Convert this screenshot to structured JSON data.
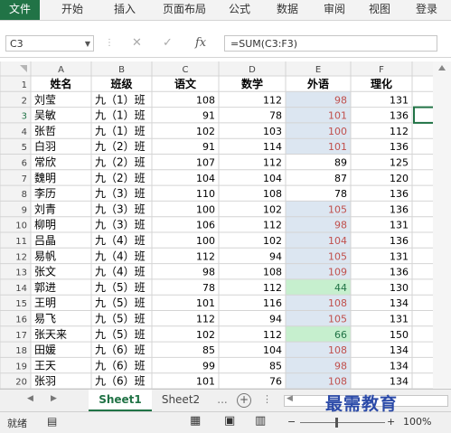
{
  "ribbon": {
    "tabs": [
      "文件",
      "开始",
      "插入",
      "页面布局",
      "公式",
      "数据",
      "审阅",
      "视图",
      "登录"
    ]
  },
  "formula_bar": {
    "name_box": "C3",
    "cancel_symbol": "✕",
    "enter_symbol": "✓",
    "fx_label": "fx",
    "formula": "=SUM(C3:F3)"
  },
  "grid": {
    "column_headers": [
      "A",
      "B",
      "C",
      "D",
      "E",
      "F"
    ],
    "row_numbers": [
      "1",
      "2",
      "3",
      "4",
      "5",
      "6",
      "7",
      "8",
      "9",
      "10",
      "11",
      "12",
      "13",
      "14",
      "15",
      "16",
      "17",
      "18",
      "19",
      "20"
    ],
    "header_row": [
      "姓名",
      "班级",
      "语文",
      "数学",
      "外语",
      "理化"
    ],
    "rows": [
      [
        "刘莹",
        "九（1）班",
        "108",
        "112",
        "98",
        "131"
      ],
      [
        "吴敏",
        "九（1）班",
        "91",
        "78",
        "101",
        "136"
      ],
      [
        "张哲",
        "九（1）班",
        "102",
        "103",
        "100",
        "112"
      ],
      [
        "白羽",
        "九（2）班",
        "91",
        "114",
        "101",
        "136"
      ],
      [
        "常欣",
        "九（2）班",
        "107",
        "112",
        "89",
        "125"
      ],
      [
        "魏明",
        "九（2）班",
        "104",
        "104",
        "87",
        "120"
      ],
      [
        "李历",
        "九（3）班",
        "110",
        "108",
        "78",
        "136"
      ],
      [
        "刘青",
        "九（3）班",
        "100",
        "102",
        "105",
        "136"
      ],
      [
        "柳明",
        "九（3）班",
        "106",
        "112",
        "98",
        "131"
      ],
      [
        "吕晶",
        "九（4）班",
        "100",
        "102",
        "104",
        "136"
      ],
      [
        "易帆",
        "九（4）班",
        "112",
        "94",
        "105",
        "131"
      ],
      [
        "张文",
        "九（4）班",
        "98",
        "108",
        "109",
        "136"
      ],
      [
        "郭进",
        "九（5）班",
        "78",
        "112",
        "44",
        "130"
      ],
      [
        "王明",
        "九（5）班",
        "101",
        "116",
        "108",
        "134"
      ],
      [
        "易飞",
        "九（5）班",
        "112",
        "94",
        "105",
        "131"
      ],
      [
        "张天来",
        "九（5）班",
        "102",
        "112",
        "66",
        "150"
      ],
      [
        "田媛",
        "九（6）班",
        "85",
        "104",
        "108",
        "134"
      ],
      [
        "王天",
        "九（6）班",
        "99",
        "85",
        "98",
        "134"
      ],
      [
        "张羽",
        "九（6）班",
        "101",
        "76",
        "108",
        "134"
      ]
    ]
  },
  "conditional_colors": {
    "high_fill": "#dce6f1",
    "high_text": "#c0504d",
    "low_fill": "#c6efce",
    "low_text": "#217346"
  },
  "sheets": {
    "tabs": [
      "Sheet1",
      "Sheet2"
    ],
    "active": "Sheet1",
    "more": "..."
  },
  "status_bar": {
    "mode": "就绪",
    "zoom": "100%"
  },
  "watermark": "最需教育",
  "accent_color": "#217346"
}
